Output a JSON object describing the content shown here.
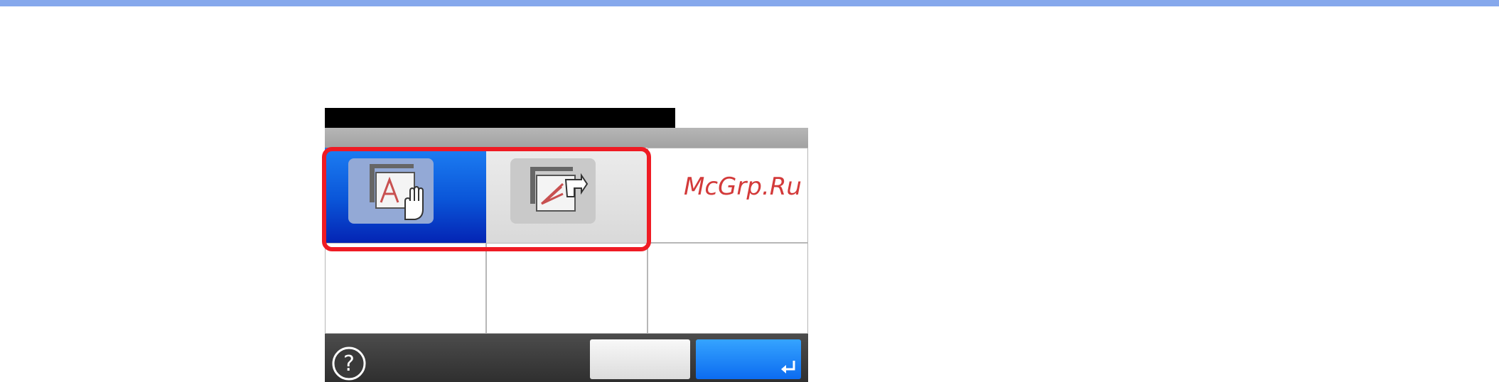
{
  "page": {
    "accent_color": "#86a8ec",
    "highlight_color": "#ef1b24"
  },
  "panel": {
    "options": [
      {
        "icon": "document-hand-icon",
        "selected": true
      },
      {
        "icon": "document-pointer-icon",
        "selected": false
      }
    ],
    "footer": {
      "help_glyph": "?",
      "help_icon": "help-circle-icon",
      "ok_icon": "enter-icon"
    }
  },
  "watermark": {
    "text": "McGrp.Ru"
  }
}
